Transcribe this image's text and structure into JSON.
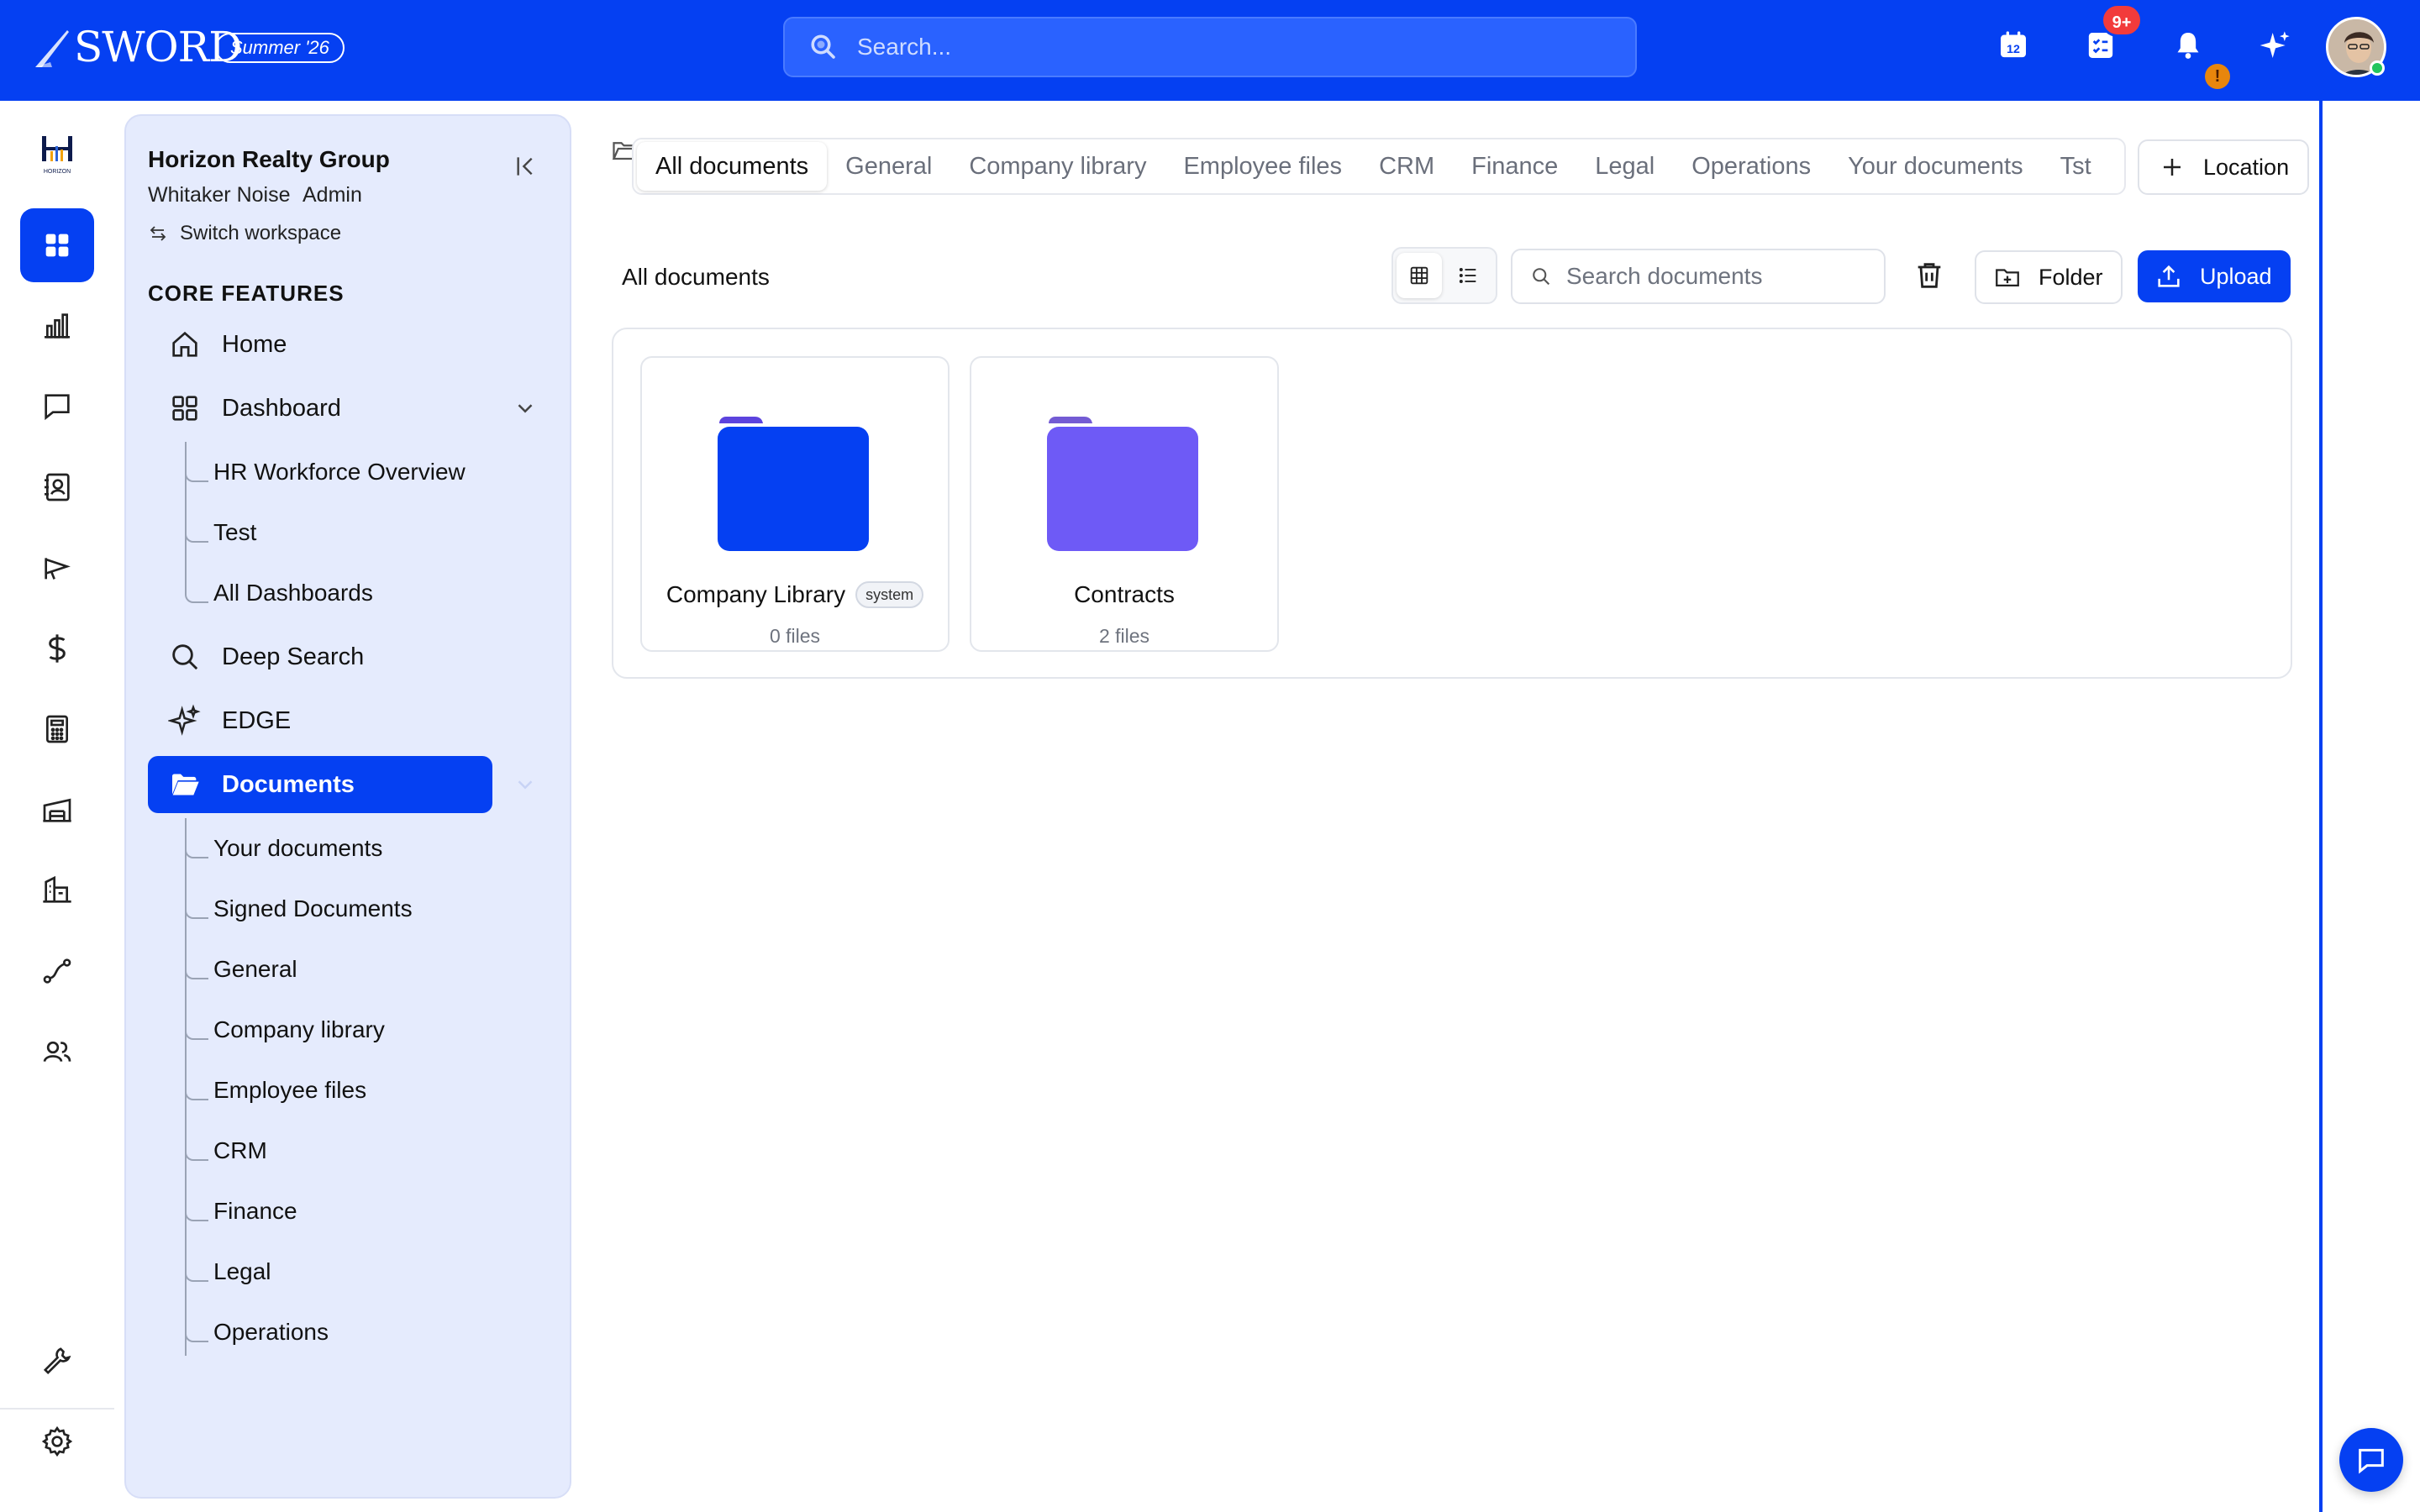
{
  "brand": {
    "name": "SWORD",
    "season": "Summer '26",
    "accent": "#0540f2"
  },
  "topbar": {
    "search_placeholder": "Search...",
    "tasks_badge": "9+",
    "notification_badge": "!",
    "icons": [
      "calendar-icon",
      "tasks-icon",
      "bell-icon",
      "sparkle-icon"
    ]
  },
  "rail": {
    "items": [
      "grid-icon",
      "chart-icon",
      "chat-icon",
      "contacts-icon",
      "megaphone-icon",
      "dollar-icon",
      "calculator-icon",
      "warehouse-icon",
      "building-icon",
      "route-icon",
      "team-icon"
    ],
    "bottom": [
      "wrench-icon",
      "gear-icon"
    ]
  },
  "workspace": {
    "name": "Horizon Realty Group",
    "user": "Whitaker Noise",
    "role": "Admin",
    "switch_label": "Switch workspace"
  },
  "sidebar": {
    "section_title": "CORE FEATURES",
    "home": "Home",
    "dashboard": "Dashboard",
    "dashboard_children": [
      "HR Workforce Overview",
      "Test",
      "All Dashboards"
    ],
    "deep_search": "Deep Search",
    "edge": "EDGE",
    "documents": "Documents",
    "documents_children": [
      "Your documents",
      "Signed Documents",
      "General",
      "Company library",
      "Employee files",
      "CRM",
      "Finance",
      "Legal",
      "Operations"
    ]
  },
  "tabs": [
    "All documents",
    "General",
    "Company library",
    "Employee files",
    "CRM",
    "Finance",
    "Legal",
    "Operations",
    "Your documents",
    "Tst"
  ],
  "active_tab": "All documents",
  "toolbar": {
    "title": "All documents",
    "search_placeholder": "Search documents",
    "location_label": "Location",
    "folder_label": "Folder",
    "upload_label": "Upload",
    "view_mode": "grid"
  },
  "folders": [
    {
      "name": "Company Library",
      "badge": "system",
      "count": "0 files",
      "color": "#0540f2"
    },
    {
      "name": "Contracts",
      "badge": "",
      "count": "2 files",
      "color": "#6e5af6"
    }
  ]
}
